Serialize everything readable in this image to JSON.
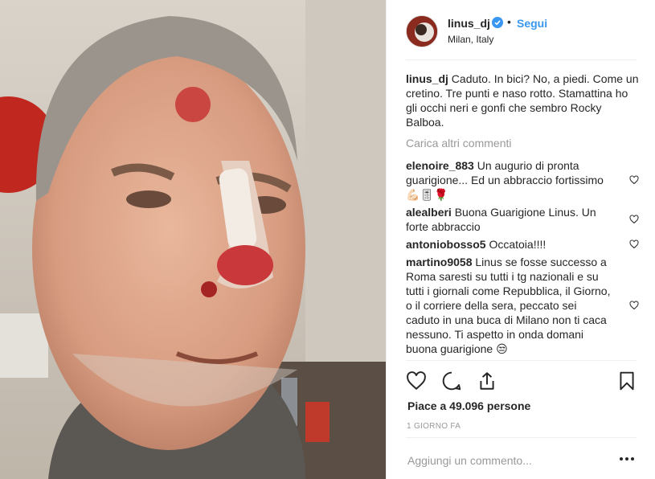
{
  "post": {
    "username": "linus_dj",
    "location": "Milan, Italy",
    "follow_label": "Segui",
    "dot": "•",
    "caption": "Caduto. In bici? No, a piedi. Come un cretino. Tre punti e naso rotto. Stamattina ho gli occhi neri e gonfi che sembro Rocky Balboa.",
    "load_more": "Carica altri commenti",
    "likes": "Piace a 49.096 persone",
    "time": "1 GIORNO FA",
    "add_comment_placeholder": "Aggiungi un commento..."
  },
  "comments": [
    {
      "user": "elenoire_883",
      "text": "Un augurio di pronta guarigione... Ed un abbraccio fortissimo 💪🏻🎚🌹"
    },
    {
      "user": "alealberi",
      "text": "Buona Guarigione Linus. Un forte abbraccio"
    },
    {
      "user": "antoniobosso5",
      "text": "Occatoia!!!!"
    },
    {
      "user": "martino9058",
      "text": "Linus se fosse successo a Roma saresti su tutti i tg nazionali e su tutti i giornali come Repubblica, il Giorno, o il corriere della sera, peccato sei caduto in una buca di Milano non ti caca nessuno. Ti aspetto in onda domani buona guarigione 😒"
    }
  ],
  "icons": {
    "verified": "verified-badge-icon",
    "like": "heart-icon",
    "comment": "comment-bubble-icon",
    "share": "share-icon",
    "save": "bookmark-icon",
    "options": "more-options-icon"
  },
  "colors": {
    "accent": "#3897f0",
    "text": "#262626",
    "muted": "#999999",
    "border": "#efefef"
  }
}
